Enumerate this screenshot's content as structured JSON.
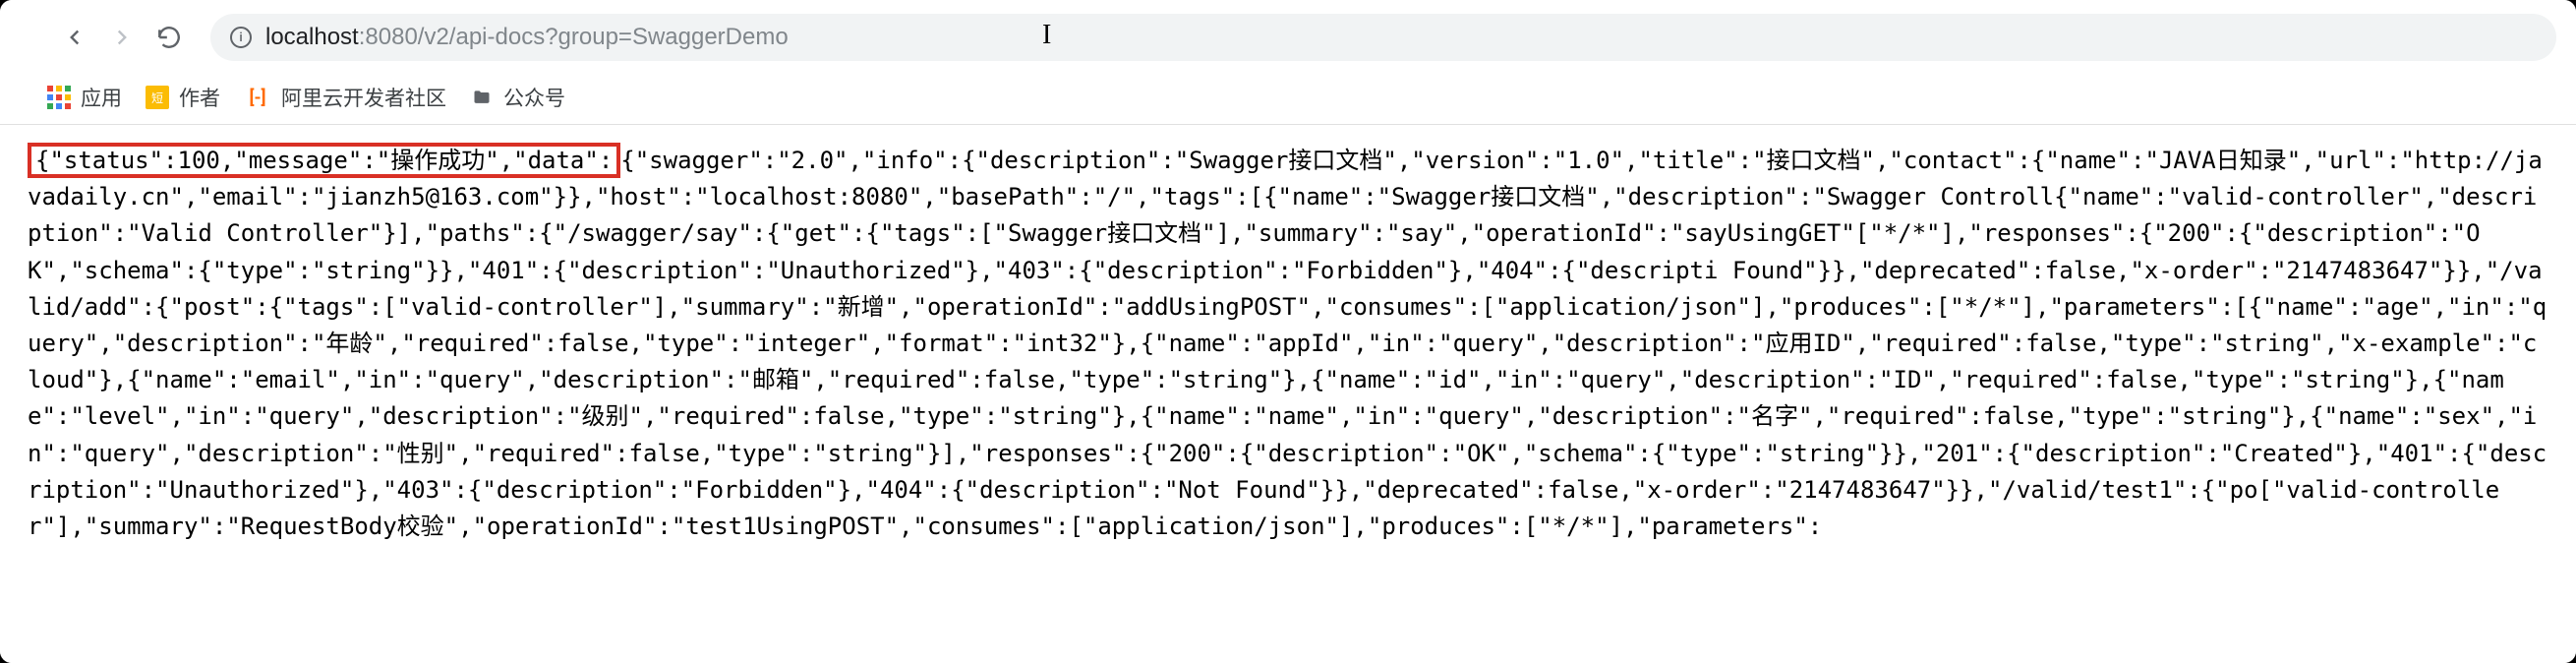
{
  "toolbar": {
    "url_host": "localhost",
    "url_port_path": ":8080/v2/api-docs?group=SwaggerDemo"
  },
  "bookmarks": {
    "apps_label": "应用",
    "author_label": "作者",
    "aliyun_label": "阿里云开发者社区",
    "gongzhonghao_label": "公众号"
  },
  "content": {
    "highlighted": "{\"status\":100,\"message\":\"操作成功\",\"data\":",
    "rest": "{\"swagger\":\"2.0\",\"info\":{\"description\":\"Swagger接口文档\",\"version\":\"1.0\",\"title\":\"接口文档\",\"contact\":{\"name\":\"JAVA日知录\",\"url\":\"http://javadaily.cn\",\"email\":\"jianzh5@163.com\"}},\"host\":\"localhost:8080\",\"basePath\":\"/\",\"tags\":[{\"name\":\"Swagger接口文档\",\"description\":\"Swagger Controll{\"name\":\"valid-controller\",\"description\":\"Valid Controller\"}],\"paths\":{\"/swagger/say\":{\"get\":{\"tags\":[\"Swagger接口文档\"],\"summary\":\"say\",\"operationId\":\"sayUsingGET\"[\"*/*\"],\"responses\":{\"200\":{\"description\":\"OK\",\"schema\":{\"type\":\"string\"}},\"401\":{\"description\":\"Unauthorized\"},\"403\":{\"description\":\"Forbidden\"},\"404\":{\"descripti Found\"}},\"deprecated\":false,\"x-order\":\"2147483647\"}},\"/valid/add\":{\"post\":{\"tags\":[\"valid-controller\"],\"summary\":\"新增\",\"operationId\":\"addUsingPOST\",\"consumes\":[\"application/json\"],\"produces\":[\"*/*\"],\"parameters\":[{\"name\":\"age\",\"in\":\"query\",\"description\":\"年龄\",\"required\":false,\"type\":\"integer\",\"format\":\"int32\"},{\"name\":\"appId\",\"in\":\"query\",\"description\":\"应用ID\",\"required\":false,\"type\":\"string\",\"x-example\":\"cloud\"},{\"name\":\"email\",\"in\":\"query\",\"description\":\"邮箱\",\"required\":false,\"type\":\"string\"},{\"name\":\"id\",\"in\":\"query\",\"description\":\"ID\",\"required\":false,\"type\":\"string\"},{\"name\":\"level\",\"in\":\"query\",\"description\":\"级别\",\"required\":false,\"type\":\"string\"},{\"name\":\"name\",\"in\":\"query\",\"description\":\"名字\",\"required\":false,\"type\":\"string\"},{\"name\":\"sex\",\"in\":\"query\",\"description\":\"性别\",\"required\":false,\"type\":\"string\"}],\"responses\":{\"200\":{\"description\":\"OK\",\"schema\":{\"type\":\"string\"}},\"201\":{\"description\":\"Created\"},\"401\":{\"description\":\"Unauthorized\"},\"403\":{\"description\":\"Forbidden\"},\"404\":{\"description\":\"Not Found\"}},\"deprecated\":false,\"x-order\":\"2147483647\"}},\"/valid/test1\":{\"po[\"valid-controller\"],\"summary\":\"RequestBody校验\",\"operationId\":\"test1UsingPOST\",\"consumes\":[\"application/json\"],\"produces\":[\"*/*\"],\"parameters\":"
  }
}
